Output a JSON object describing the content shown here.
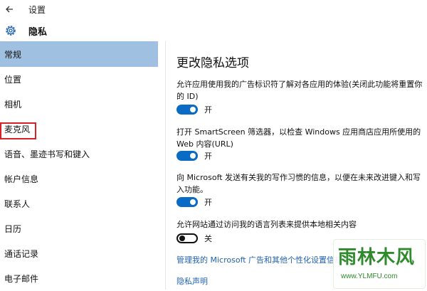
{
  "titlebar": {
    "back_icon": "arrow-left-icon",
    "title": "设置"
  },
  "header": {
    "icon": "gear-icon",
    "title": "隐私"
  },
  "sidebar": {
    "items": [
      {
        "label": "常规",
        "selected": true
      },
      {
        "label": "位置"
      },
      {
        "label": "相机"
      },
      {
        "label": "麦克风",
        "highlighted": true
      },
      {
        "label": "语音、墨迹书写和键入"
      },
      {
        "label": "帐户信息"
      },
      {
        "label": "联系人"
      },
      {
        "label": "日历"
      },
      {
        "label": "通话记录"
      },
      {
        "label": "电子邮件"
      }
    ]
  },
  "main": {
    "title": "更改隐私选项",
    "settings": [
      {
        "desc": "允许应用使用我的广告标识符了解对各应用的体验(关闭此功能将重置你的 ID)",
        "state": "开"
      },
      {
        "desc": "打开 SmartScreen 筛选器，以检查 Windows 应用商店应用所使用的 Web 内容(URL)",
        "state": "开"
      },
      {
        "desc": "向 Microsoft 发送有关我的写作习惯的信息，以便在未来改进键入和写入功能。",
        "state": "开"
      },
      {
        "desc": "允许网站通过访问我的语言列表来提供本地相关内容",
        "state": "关"
      }
    ],
    "link_manage": "管理我的 Microsoft 广告和其他个性化设置信息",
    "link_privacy": "隐私声明"
  },
  "watermark": {
    "logo": "雨林木风",
    "url": "www.YLMFU.com"
  },
  "colors": {
    "accent": "#0a6bc4",
    "selected": "#9fc0e0",
    "highlight_box": "#d8202a",
    "link": "#1f62b0",
    "watermark": "#2e8a2a"
  }
}
